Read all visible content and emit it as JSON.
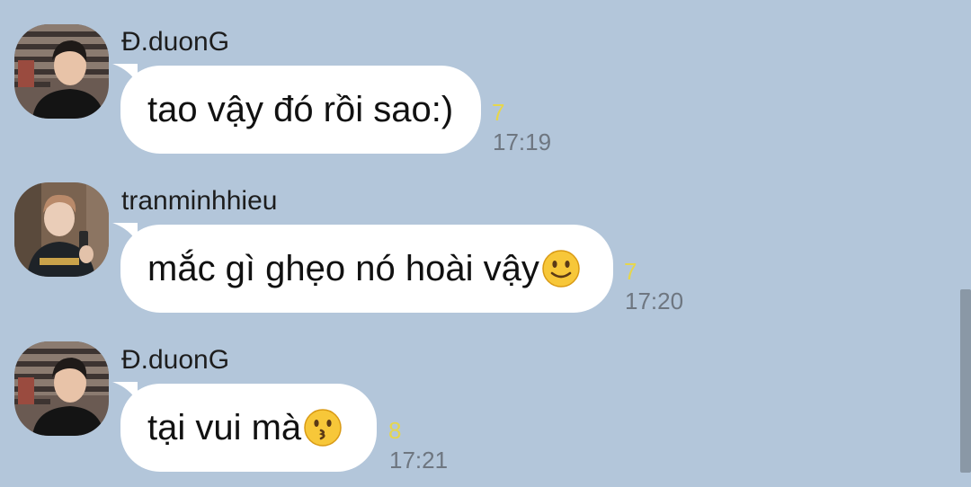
{
  "messages": [
    {
      "sender": "Đ.duonG",
      "text": "tao vậy đó rồi sao:)",
      "emoji": "",
      "read_count": "7",
      "time": "17:19",
      "avatar": "avatar-man-dark-shirt"
    },
    {
      "sender": "tranminhhieu",
      "text": "mắc gì ghẹo nó hoài vậy",
      "emoji": "slightly-smiling-face-emoji",
      "read_count": "7",
      "time": "17:20",
      "avatar": "avatar-man-selfie"
    },
    {
      "sender": "Đ.duonG",
      "text": "tại vui mà",
      "emoji": "kissing-face-emoji",
      "read_count": "8",
      "time": "17:21",
      "avatar": "avatar-man-dark-shirt"
    }
  ],
  "colors": {
    "background": "#b3c6da",
    "bubble": "#ffffff",
    "read_count": "#e6d64c",
    "timestamp": "#6e7680"
  }
}
